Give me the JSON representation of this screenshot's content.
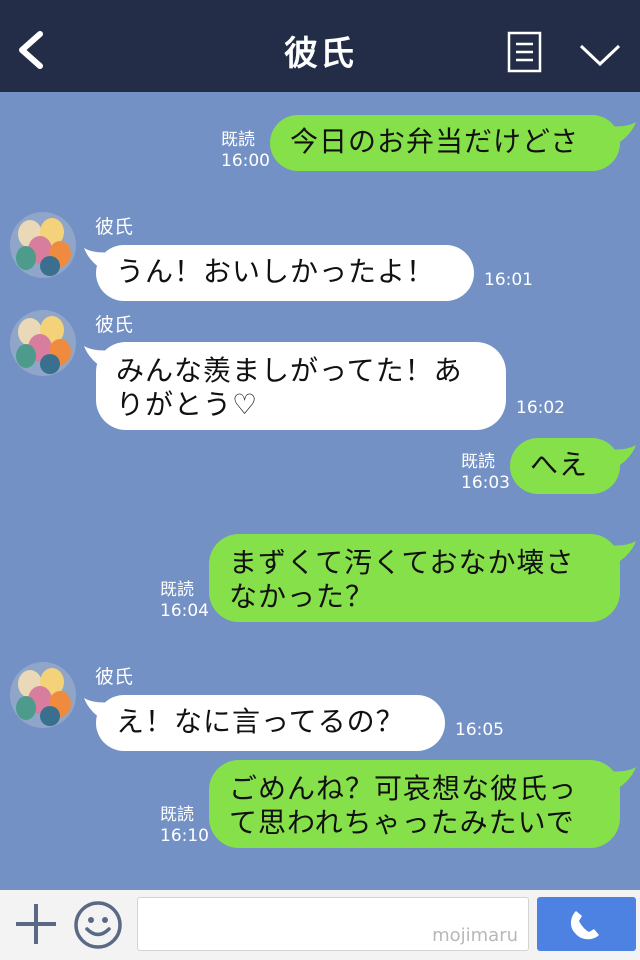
{
  "header": {
    "title": "彼氏",
    "back_icon": "chevron-left-icon",
    "menu_icon": "notes-icon",
    "collapse_icon": "chevron-down-icon"
  },
  "messages": [
    {
      "side": "out",
      "text": "今日のお弁当だけどさ",
      "read": "既読",
      "time": "16:00"
    },
    {
      "side": "in",
      "sender": "彼氏",
      "text": "うん！おいしかったよ！",
      "time": "16:01"
    },
    {
      "side": "in",
      "sender": "彼氏",
      "text_lines": [
        "みんな羨ましがってた！あ",
        "りがとう♡"
      ],
      "time": "16:02"
    },
    {
      "side": "out",
      "text": "へえ",
      "read": "既読",
      "time": "16:03"
    },
    {
      "side": "out",
      "text_lines": [
        "まずくて汚くておなか壊さ",
        "なかった？"
      ],
      "read": "既読",
      "time": "16:04"
    },
    {
      "side": "in",
      "sender": "彼氏",
      "text": "え！なに言ってるの？",
      "time": "16:05"
    },
    {
      "side": "out",
      "text_lines": [
        "ごめんね？可哀想な彼氏っ",
        "て思われちゃったみたいで"
      ],
      "read": "既読",
      "time": "16:10"
    }
  ],
  "footer": {
    "watermark": "mojimaru",
    "plus_icon": "plus-icon",
    "sticker_icon": "smile-icon",
    "call_icon": "phone-icon"
  },
  "colors": {
    "background": "#7391c5",
    "header": "#232d47",
    "outgoing_bubble": "#86e04a",
    "incoming_bubble": "#ffffff",
    "send_button": "#4d82e3"
  }
}
